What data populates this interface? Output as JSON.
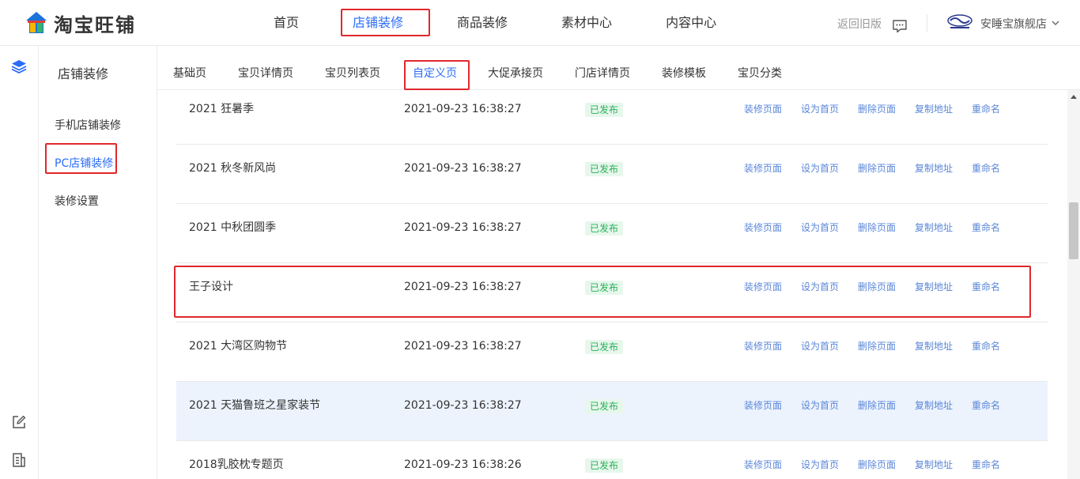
{
  "header": {
    "logo_text": "淘宝旺铺",
    "nav": [
      {
        "label": "首页"
      },
      {
        "label": "店铺装修"
      },
      {
        "label": "商品装修"
      },
      {
        "label": "素材中心"
      },
      {
        "label": "内容中心"
      }
    ],
    "back_old": "返回旧版",
    "shop_name": "安睡宝旗舰店"
  },
  "sidebar": {
    "title": "店铺装修",
    "items": [
      {
        "label": "手机店铺装修"
      },
      {
        "label": "PC店铺装修"
      },
      {
        "label": "装修设置"
      }
    ]
  },
  "tabs": [
    {
      "label": "基础页"
    },
    {
      "label": "宝贝详情页"
    },
    {
      "label": "宝贝列表页"
    },
    {
      "label": "自定义页"
    },
    {
      "label": "大促承接页"
    },
    {
      "label": "门店详情页"
    },
    {
      "label": "装修模板"
    },
    {
      "label": "宝贝分类"
    }
  ],
  "pages": [
    {
      "name": "2021 狂暑季",
      "time": "2021-09-23 16:38:27",
      "status": "已发布"
    },
    {
      "name": "2021 秋冬新风尚",
      "time": "2021-09-23 16:38:27",
      "status": "已发布"
    },
    {
      "name": "2021 中秋团圆季",
      "time": "2021-09-23 16:38:27",
      "status": "已发布"
    },
    {
      "name": "王子设计",
      "time": "2021-09-23 16:38:27",
      "status": "已发布"
    },
    {
      "name": "2021 大湾区购物节",
      "time": "2021-09-23 16:38:27",
      "status": "已发布"
    },
    {
      "name": "2021 天猫鲁班之星家装节",
      "time": "2021-09-23 16:38:27",
      "status": "已发布"
    },
    {
      "name": "2018乳胶枕专题页",
      "time": "2021-09-23 16:38:26",
      "status": "已发布"
    }
  ],
  "actions": {
    "edit": "装修页面",
    "set_home": "设为首页",
    "delete": "删除页面",
    "copy_url": "复制地址",
    "rename": "重命名"
  },
  "colors": {
    "accent": "#2b6cf6",
    "highlight_box": "#e0282d",
    "link": "#5a86d8",
    "status_green": "#28b15a",
    "row_hover": "#ecf3fd"
  }
}
